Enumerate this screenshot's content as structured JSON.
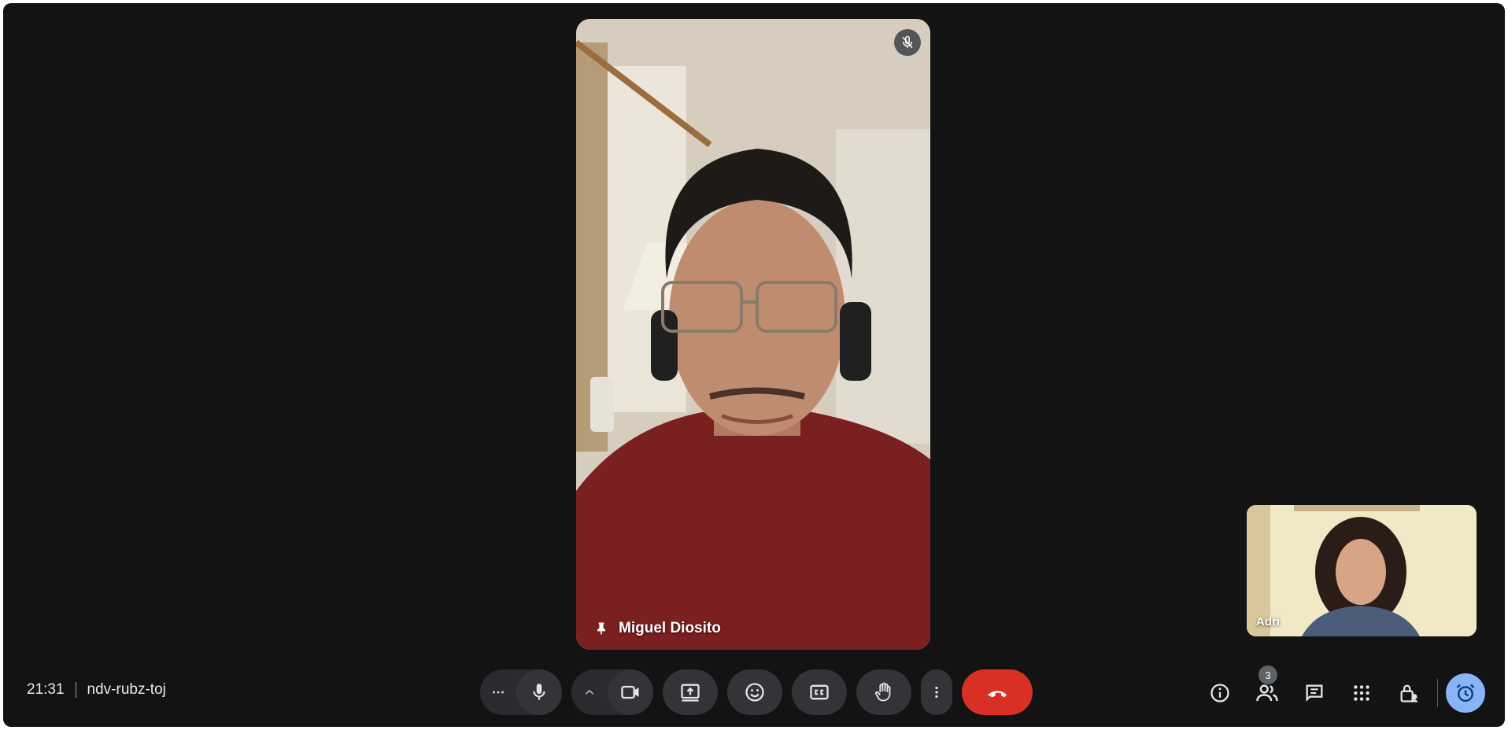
{
  "meeting": {
    "time": "21:31",
    "code": "ndv-rubz-toj"
  },
  "main_tile": {
    "participant_name": "Miguel Diosito",
    "muted": true,
    "pinned": true
  },
  "self_view": {
    "name_label": "Adri"
  },
  "controls": [
    {
      "name": "more-options-left",
      "icon": "more-horiz-icon"
    },
    {
      "name": "microphone",
      "icon": "mic-icon"
    },
    {
      "name": "camera-options",
      "icon": "chevron-up-icon"
    },
    {
      "name": "camera",
      "icon": "videocam-icon"
    },
    {
      "name": "present-screen",
      "icon": "present-icon"
    },
    {
      "name": "reactions",
      "icon": "emoji-icon"
    },
    {
      "name": "captions",
      "icon": "cc-icon"
    },
    {
      "name": "raise-hand",
      "icon": "hand-icon"
    },
    {
      "name": "more-options",
      "icon": "more-vert-icon"
    },
    {
      "name": "leave-call",
      "icon": "call-end-icon"
    }
  ],
  "right_tools": {
    "people_count": "3"
  },
  "colors": {
    "background": "#131314",
    "button": "#333437",
    "end_call": "#d93025",
    "accent": "#8ab4f8"
  }
}
